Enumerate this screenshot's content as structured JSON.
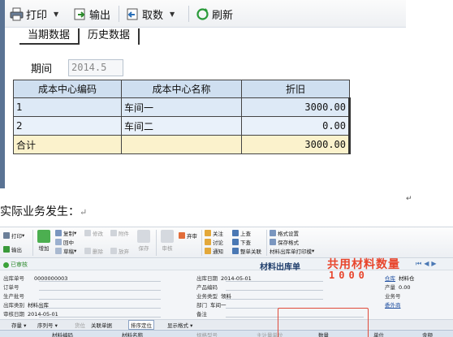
{
  "top_panel": {
    "toolbar": {
      "print_label": "打印",
      "export_label": "输出",
      "fetch_label": "取数",
      "refresh_label": "刷新"
    },
    "tabs": [
      "当期数据",
      "历史数据"
    ],
    "period": {
      "label": "期间",
      "value": "2014.5"
    },
    "table": {
      "columns": [
        "成本中心编码",
        "成本中心名称",
        "折旧"
      ],
      "rows": [
        {
          "code": "1",
          "name": "车间一",
          "depreciation": "3000.00"
        },
        {
          "code": "2",
          "name": "车间二",
          "depreciation": "0.00"
        }
      ],
      "total": {
        "label": "合计",
        "depreciation": "3000.00"
      }
    }
  },
  "mid_text": "实际业务发生：",
  "bottom_panel": {
    "ribbon": {
      "print": "打印",
      "export": "输出",
      "add": "增加",
      "copy": "复制",
      "draft": "草稿",
      "modify": "修改",
      "delete": "删除",
      "attachment": "附件",
      "abandon": "放弃",
      "save": "保存",
      "audit": "审核",
      "discard": "弃审",
      "chain": "关注",
      "discuss": "讨论",
      "notify": "通知",
      "up": "上查",
      "down": "下查",
      "whole_link": "整单关联",
      "format_setting": "格式设置",
      "save_format": "保存格式",
      "print_template": "材料出库单打印模",
      "pin": "回中",
      "locate": "定位"
    },
    "status": "已审核",
    "form_title": "材料出库单",
    "overlay": {
      "text": "共用材料数量",
      "number": "1000"
    },
    "fields": {
      "out_no_label": "出库单号",
      "out_no": "0000000003",
      "order_no_label": "订单号",
      "batch_label": "生产批号",
      "category_label": "出库类别",
      "category": "材料出库",
      "audit_date_label": "审核日期",
      "audit_date": "2014-05-01",
      "out_date_label": "出库日期",
      "out_date": "2014-05-01",
      "product_code_label": "产品编码",
      "biz_type_label": "业务类型",
      "biz_type": "领料",
      "dept_label": "部门",
      "dept": "车间一",
      "note_label": "备注",
      "warehouse_label": "仓库",
      "warehouse": "材料仓",
      "quantity_label": "产量",
      "quantity": "0.00",
      "biz_no_label": "业务号",
      "bill_label": "委外商"
    },
    "tabbar": [
      "存量",
      "序列号",
      "货位",
      "关联单据",
      "排序定位",
      "显示格式"
    ],
    "grid_columns": [
      "材料编码",
      "材料名称",
      "规格型号",
      "主计量单位",
      "数量",
      "单位",
      "金额"
    ]
  },
  "colors": {
    "header_blue": "#cfdff0",
    "row_blue": "#dde9f6",
    "total_yellow": "#fbf2cc",
    "overlay_red": "#e8452c",
    "approved_green": "#2d8a2d",
    "title_navy": "#1e3d6b"
  }
}
